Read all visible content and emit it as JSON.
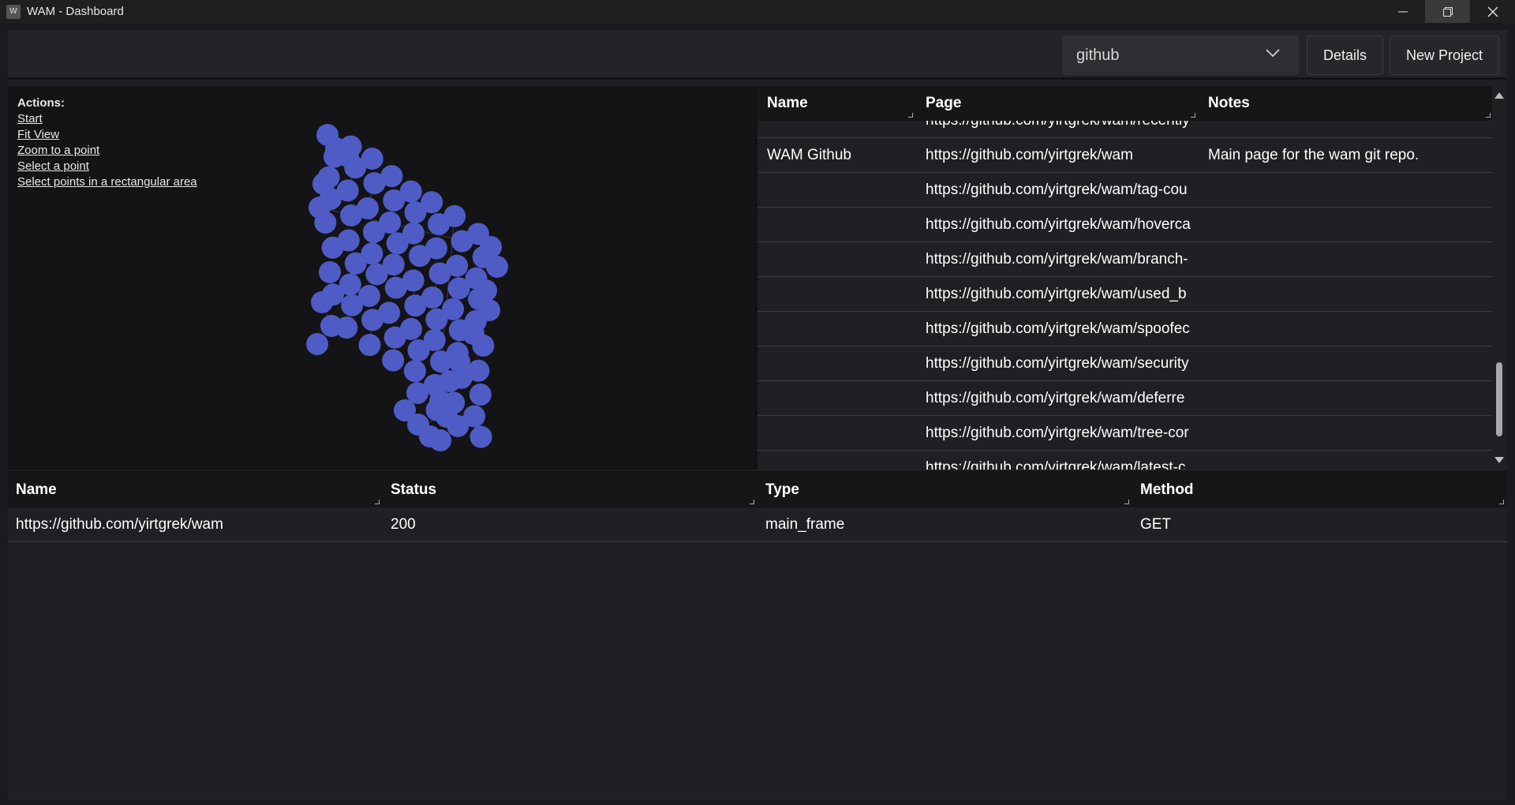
{
  "window": {
    "title": "WAM - Dashboard",
    "icon_letter": "W"
  },
  "toolbar": {
    "project_select": "github",
    "details_label": "Details",
    "new_project_label": "New Project"
  },
  "graph": {
    "actions_header": "Actions:",
    "actions": [
      "Start",
      "Fit View",
      "Zoom to a point",
      "Select a point",
      "Select points in a rectangular area"
    ],
    "node_color": "#4f5cc6",
    "edge_color": "#3a3a4a"
  },
  "pages_table": {
    "columns": [
      "Name",
      "Page",
      "Notes"
    ],
    "rows": [
      {
        "name": "",
        "page": "https://github.com/yirtgrek/wam/recently",
        "notes": ""
      },
      {
        "name": "WAM Github",
        "page": "https://github.com/yirtgrek/wam",
        "notes": "Main page for the wam git repo."
      },
      {
        "name": "",
        "page": "https://github.com/yirtgrek/wam/tag-cou",
        "notes": ""
      },
      {
        "name": "",
        "page": "https://github.com/yirtgrek/wam/hoverca",
        "notes": ""
      },
      {
        "name": "",
        "page": "https://github.com/yirtgrek/wam/branch-",
        "notes": ""
      },
      {
        "name": "",
        "page": "https://github.com/yirtgrek/wam/used_b",
        "notes": ""
      },
      {
        "name": "",
        "page": "https://github.com/yirtgrek/wam/spoofec",
        "notes": ""
      },
      {
        "name": "",
        "page": "https://github.com/yirtgrek/wam/security",
        "notes": ""
      },
      {
        "name": "",
        "page": "https://github.com/yirtgrek/wam/deferre",
        "notes": ""
      },
      {
        "name": "",
        "page": "https://github.com/yirtgrek/wam/tree-cor",
        "notes": ""
      },
      {
        "name": "",
        "page": "https://github.com/yirtgrek/wam/latest-c",
        "notes": ""
      }
    ]
  },
  "requests_table": {
    "columns": [
      "Name",
      "Status",
      "Type",
      "Method"
    ],
    "rows": [
      {
        "name": "https://github.com/yirtgrek/wam",
        "status": "200",
        "type": "main_frame",
        "method": "GET"
      }
    ]
  }
}
